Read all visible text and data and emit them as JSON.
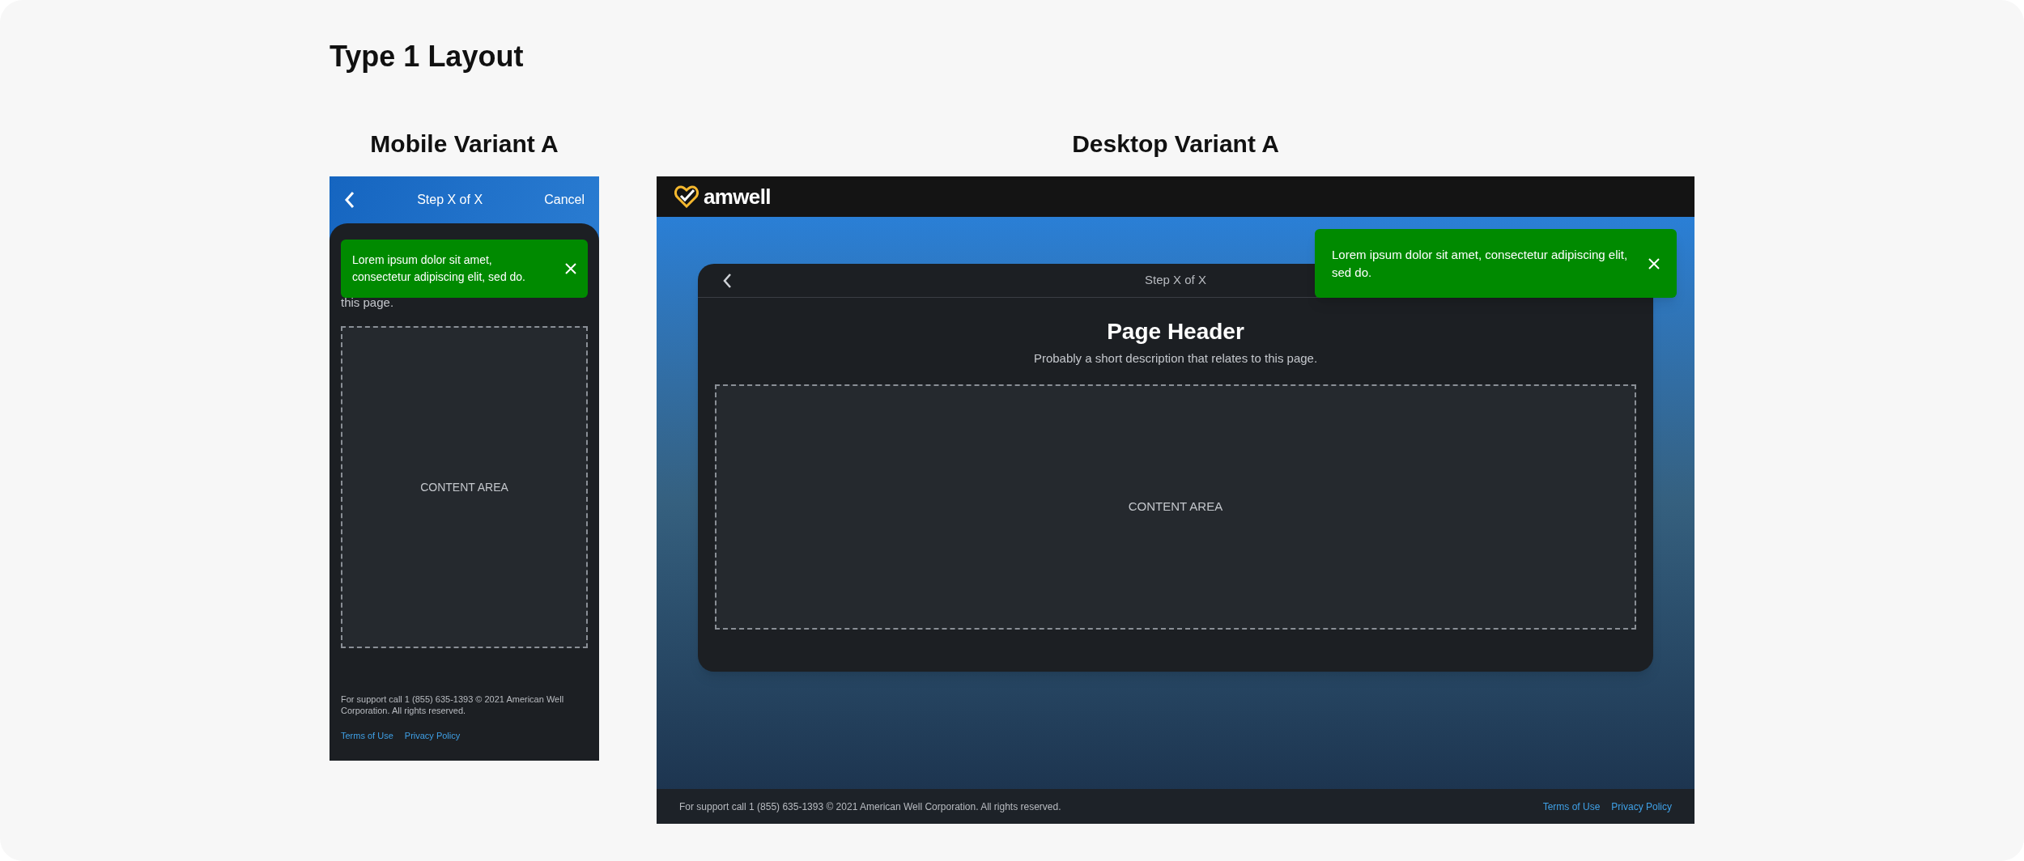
{
  "page_title": "Type 1 Layout",
  "mobile": {
    "heading": "Mobile Variant A",
    "header": {
      "step": "Step X of X",
      "cancel": "Cancel"
    },
    "toast": {
      "message": "Lorem ipsum dolor sit amet, consectetur adipiscing elit, sed do."
    },
    "description": "this page.",
    "content_area": "CONTENT AREA",
    "footer": {
      "support": "For support call 1 (855) 635-1393 © 2021 American Well Corporation. All rights reserved.",
      "links": [
        "Terms of Use",
        "Privacy Policy"
      ]
    }
  },
  "desktop": {
    "heading": "Desktop Variant A",
    "brand": "amwell",
    "card": {
      "step": "Step X of X",
      "title": "Page Header",
      "description": "Probably a short description that relates to this page.",
      "content_area": "CONTENT AREA"
    },
    "toast": {
      "message": "Lorem ipsum dolor sit amet, consectetur adipiscing elit, sed do."
    },
    "footer": {
      "support": "For support call 1 (855) 635-1393 © 2021 American Well Corporation. All rights reserved.",
      "links": [
        "Terms of Use",
        "Privacy Policy"
      ]
    }
  }
}
